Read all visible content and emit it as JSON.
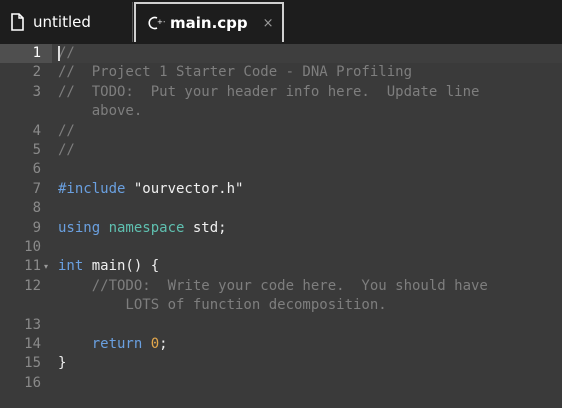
{
  "tabs": [
    {
      "label": "untitled",
      "icon": "file-icon",
      "active": false
    },
    {
      "label": "main.cpp",
      "icon": "cpp-icon",
      "active": true,
      "close": "×"
    }
  ],
  "editor": {
    "lines": [
      {
        "n": "1",
        "parts": [
          {
            "t": "//",
            "c": "comment"
          }
        ]
      },
      {
        "n": "2",
        "parts": [
          {
            "t": "//  Project 1 Starter Code - DNA Profiling",
            "c": "comment"
          }
        ]
      },
      {
        "n": "3",
        "parts": [
          {
            "t": "//  TODO:  Put your header info here.  Update line",
            "c": "comment"
          }
        ]
      },
      {
        "n": "",
        "parts": [
          {
            "t": "    above.",
            "c": "comment"
          }
        ]
      },
      {
        "n": "4",
        "parts": [
          {
            "t": "//",
            "c": "comment"
          }
        ]
      },
      {
        "n": "5",
        "parts": [
          {
            "t": "//",
            "c": "comment"
          }
        ]
      },
      {
        "n": "6",
        "parts": []
      },
      {
        "n": "7",
        "parts": [
          {
            "t": "#include ",
            "c": "kw"
          },
          {
            "t": "\"ourvector.h\"",
            "c": "str"
          }
        ]
      },
      {
        "n": "8",
        "parts": []
      },
      {
        "n": "9",
        "parts": [
          {
            "t": "using ",
            "c": "kw"
          },
          {
            "t": "namespace ",
            "c": "ns"
          },
          {
            "t": "std;",
            "c": ""
          }
        ]
      },
      {
        "n": "10",
        "parts": []
      },
      {
        "n": "11",
        "fold": "▾",
        "parts": [
          {
            "t": "int ",
            "c": "type"
          },
          {
            "t": "main() {",
            "c": ""
          }
        ]
      },
      {
        "n": "12",
        "parts": [
          {
            "t": "    //TODO:  Write your code here.  You should have",
            "c": "comment"
          }
        ]
      },
      {
        "n": "",
        "parts": [
          {
            "t": "        LOTS of function decomposition.",
            "c": "comment"
          }
        ]
      },
      {
        "n": "13",
        "parts": []
      },
      {
        "n": "14",
        "parts": [
          {
            "t": "    return ",
            "c": "kw"
          },
          {
            "t": "0",
            "c": "num"
          },
          {
            "t": ";",
            "c": ""
          }
        ]
      },
      {
        "n": "15",
        "parts": [
          {
            "t": "}",
            "c": ""
          }
        ]
      },
      {
        "n": "16",
        "parts": []
      }
    ]
  },
  "colors": {
    "background": "#3a3a3a",
    "tabbar": "#1d1d1d",
    "comment": "#7e7e7e",
    "keyword": "#6aa0e0",
    "namespace": "#5fc0b0",
    "number": "#e4a84c"
  }
}
